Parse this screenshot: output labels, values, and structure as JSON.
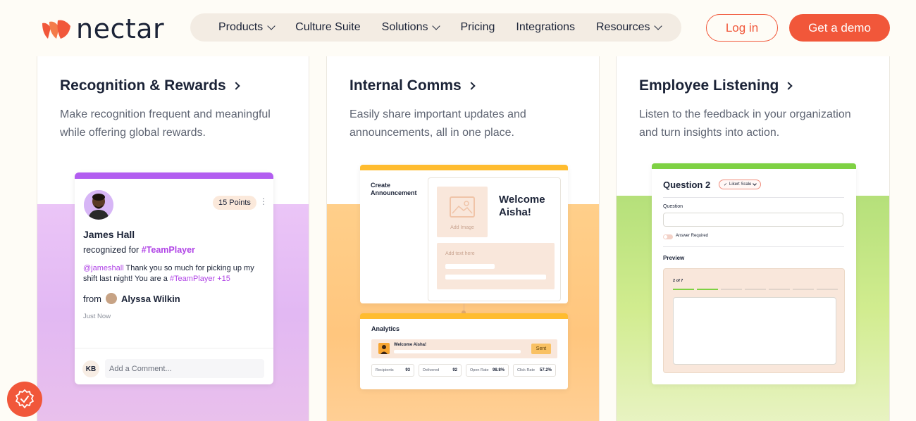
{
  "brand": {
    "name": "nectar",
    "accent": "#f1573a"
  },
  "nav": {
    "items": [
      {
        "label": "Products",
        "dropdown": true
      },
      {
        "label": "Culture Suite",
        "dropdown": false
      },
      {
        "label": "Solutions",
        "dropdown": true
      },
      {
        "label": "Pricing",
        "dropdown": false
      },
      {
        "label": "Integrations",
        "dropdown": false
      },
      {
        "label": "Resources",
        "dropdown": true
      }
    ],
    "login": "Log in",
    "demo": "Get a demo"
  },
  "cards": [
    {
      "title": "Recognition & Rewards",
      "desc": "Make recognition frequent and meaningful while offering global rewards.",
      "accent": "#b25df0"
    },
    {
      "title": "Internal Comms",
      "desc": "Easily share important updates and announcements, all in one place.",
      "accent": "#ffbc2f"
    },
    {
      "title": "Employee Listening",
      "desc": "Listen to the feedback in your organization and turn insights into action.",
      "accent": "#7ed143"
    }
  ],
  "recognition": {
    "points": "15 Points",
    "menu": "⋮",
    "name": "James Hall",
    "recognized_prefix": "recognized for",
    "tag": "#TeamPlayer",
    "mention": "@jameshall",
    "message_mid": "Thank you so much for picking up my shift last night! You are a",
    "message_tag": "#TeamPlayer +15",
    "from_prefix": "from",
    "from_name": "Alyssa Wilkin",
    "time": "Just Now",
    "initials": "KB",
    "comment_placeholder": "Add a Comment..."
  },
  "comms": {
    "create_label": "Create Announcement",
    "add_image": "Add Image",
    "welcome": "Welcome Aisha!",
    "add_text": "Add text here",
    "analytics": "Analytics",
    "row_title": "Welcome Aisha!",
    "sent": "Sent",
    "stats": [
      {
        "label": "Recipients",
        "value": "93"
      },
      {
        "label": "Delivered",
        "value": "92"
      },
      {
        "label": "Open Rate",
        "value": "98.8%"
      },
      {
        "label": "Click Rate",
        "value": "57.2%"
      }
    ]
  },
  "listening": {
    "question_title": "Question 2",
    "scale": "Likert Scale",
    "question_label": "Question",
    "answer_required": "Answer Required",
    "preview": "Preview",
    "step": "2 of 7",
    "progress_steps_total": 7,
    "progress_steps_done": 2
  }
}
